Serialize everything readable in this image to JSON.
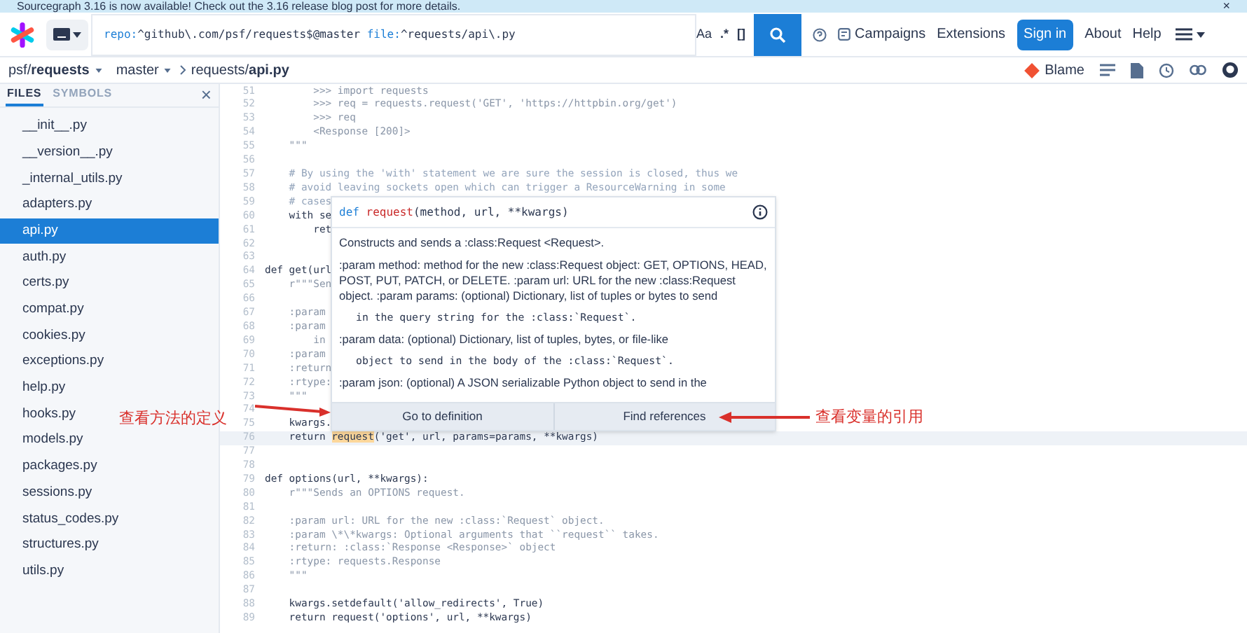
{
  "banner": {
    "text": "Sourcegraph 3.16 is now available! Check out the 3.16 release blog post for more details.",
    "close": "×"
  },
  "navbar": {
    "query": [
      {
        "text": "repo:",
        "kind": "filter"
      },
      {
        "text": "^github\\.com/psf/requests$@master ",
        "kind": "value"
      },
      {
        "text": "file:",
        "kind": "filter"
      },
      {
        "text": "^requests/api\\.py",
        "kind": "value"
      }
    ],
    "case_toggle": "Aa",
    "regex_toggle": ".*",
    "structural_toggle": "[]",
    "links": [
      {
        "label": "Campaigns",
        "kind": "icon-link"
      },
      {
        "label": "Extensions",
        "kind": "link"
      },
      {
        "label": "Sign in",
        "kind": "primary"
      },
      {
        "label": "About",
        "kind": "link"
      },
      {
        "label": "Help",
        "kind": "link"
      }
    ]
  },
  "breadcrumb": {
    "repo": "psf/**requests**",
    "revision": "master",
    "path": "requests/**api.py**",
    "blame": "Blame"
  },
  "sidebar": {
    "tabs": [
      {
        "label": "FILES",
        "selected": true
      },
      {
        "label": "SYMBOLS",
        "selected": false
      }
    ],
    "close": "×",
    "files": [
      {
        "name": "__init__.py",
        "selected": false
      },
      {
        "name": "__version__.py",
        "selected": false
      },
      {
        "name": "_internal_utils.py",
        "selected": false
      },
      {
        "name": "adapters.py",
        "selected": false
      },
      {
        "name": "api.py",
        "selected": true
      },
      {
        "name": "auth.py",
        "selected": false
      },
      {
        "name": "certs.py",
        "selected": false
      },
      {
        "name": "compat.py",
        "selected": false
      },
      {
        "name": "cookies.py",
        "selected": false
      },
      {
        "name": "exceptions.py",
        "selected": false
      },
      {
        "name": "help.py",
        "selected": false
      },
      {
        "name": "hooks.py",
        "selected": false
      },
      {
        "name": "models.py",
        "selected": false
      },
      {
        "name": "packages.py",
        "selected": false
      },
      {
        "name": "sessions.py",
        "selected": false
      },
      {
        "name": "status_codes.py",
        "selected": false
      },
      {
        "name": "structures.py",
        "selected": false
      },
      {
        "name": "utils.py",
        "selected": false
      }
    ]
  },
  "code": {
    "lines": [
      {
        "num": "51",
        "kind": "docstring",
        "text": "        >>> import requests"
      },
      {
        "num": "52",
        "kind": "docstring",
        "text": "        >>> req = requests.request('GET', 'https://httpbin.org/get')"
      },
      {
        "num": "53",
        "kind": "docstring",
        "text": "        >>> req"
      },
      {
        "num": "54",
        "kind": "docstring",
        "text": "        <Response [200]>"
      },
      {
        "num": "55",
        "kind": "docstring",
        "text": "    \"\"\""
      },
      {
        "num": "56",
        "kind": "blank"
      },
      {
        "num": "57",
        "kind": "comment",
        "text": "    # By using the 'with' statement we are sure the session is closed, thus we"
      },
      {
        "num": "58",
        "kind": "comment",
        "text": "    # avoid leaving sockets open which can trigger a ResourceWarning in some"
      },
      {
        "num": "59",
        "kind": "comment",
        "text": "    # cases"
      },
      {
        "num": "60",
        "kind": "code",
        "text": "    with se"
      },
      {
        "num": "61",
        "kind": "code",
        "text": "        ret"
      },
      {
        "num": "62",
        "kind": "blank"
      },
      {
        "num": "63",
        "kind": "blank"
      },
      {
        "num": "64",
        "kind": "code",
        "text": "def get(url"
      },
      {
        "num": "65",
        "kind": "docstring",
        "text": "    r\"\"\"Sen"
      },
      {
        "num": "66",
        "kind": "blank"
      },
      {
        "num": "67",
        "kind": "docstring",
        "text": "    :param"
      },
      {
        "num": "68",
        "kind": "docstring",
        "text": "    :param"
      },
      {
        "num": "69",
        "kind": "docstring",
        "text": "        in"
      },
      {
        "num": "70",
        "kind": "docstring",
        "text": "    :param"
      },
      {
        "num": "71",
        "kind": "docstring",
        "text": "    :return"
      },
      {
        "num": "72",
        "kind": "docstring",
        "text": "    :rtype:"
      },
      {
        "num": "73",
        "kind": "docstring",
        "text": "    \"\"\""
      },
      {
        "num": "74",
        "kind": "blank"
      },
      {
        "num": "75",
        "kind": "code",
        "text": "    kwargs."
      },
      {
        "num": "76",
        "kind": "code",
        "selected": true,
        "segments": [
          {
            "text": "    return ",
            "highlighted": false
          },
          {
            "text": "request",
            "highlighted": true
          },
          {
            "text": "('get', url, params=params, **kwargs)",
            "highlighted": false
          }
        ]
      },
      {
        "num": "77",
        "kind": "blank"
      },
      {
        "num": "78",
        "kind": "blank"
      },
      {
        "num": "79",
        "kind": "code",
        "text": "def options(url, **kwargs):"
      },
      {
        "num": "80",
        "kind": "docstring",
        "text": "    r\"\"\"Sends an OPTIONS request."
      },
      {
        "num": "81",
        "kind": "blank"
      },
      {
        "num": "82",
        "kind": "docstring",
        "text": "    :param url: URL for the new :class:`Request` object."
      },
      {
        "num": "83",
        "kind": "docstring",
        "text": "    :param \\*\\*kwargs: Optional arguments that ``request`` takes."
      },
      {
        "num": "84",
        "kind": "docstring",
        "text": "    :return: :class:`Response <Response>` object"
      },
      {
        "num": "85",
        "kind": "docstring",
        "text": "    :rtype: requests.Response"
      },
      {
        "num": "86",
        "kind": "docstring",
        "text": "    \"\"\""
      },
      {
        "num": "87",
        "kind": "blank"
      },
      {
        "num": "88",
        "kind": "code",
        "text": "    kwargs.setdefault('allow_redirects', True)"
      },
      {
        "num": "89",
        "kind": "code",
        "text": "    return request('options', url, **kwargs)"
      }
    ]
  },
  "hover": {
    "signature": [
      {
        "text": "def ",
        "kind": "keyword"
      },
      {
        "text": "request",
        "kind": "function"
      },
      {
        "text": "(method, url, **kwargs)",
        "kind": "plain"
      }
    ],
    "paragraphs": [
      {
        "kind": "prose",
        "text": "Constructs and sends a :class:Request <Request>."
      },
      {
        "kind": "prose",
        "text": ":param method: method for the new :class:Request object: GET, OPTIONS, HEAD, POST, PUT, PATCH, or DELETE. :param url: URL for the new :class:Request object. :param params: (optional) Dictionary, list of tuples or bytes to send"
      },
      {
        "kind": "code",
        "text": "in the query string for the :class:`Request`."
      },
      {
        "kind": "prose",
        "text": ":param data: (optional) Dictionary, list of tuples, bytes, or file-like"
      },
      {
        "kind": "code",
        "text": "object to send in the body of the :class:`Request`."
      },
      {
        "kind": "prose",
        "text": ":param json: (optional) A JSON serializable Python object to send in the"
      }
    ],
    "actions": [
      "Go to definition",
      "Find references"
    ]
  },
  "annotations": [
    {
      "text": "查看方法的定义"
    },
    {
      "text": "查看变量的引用"
    }
  ]
}
